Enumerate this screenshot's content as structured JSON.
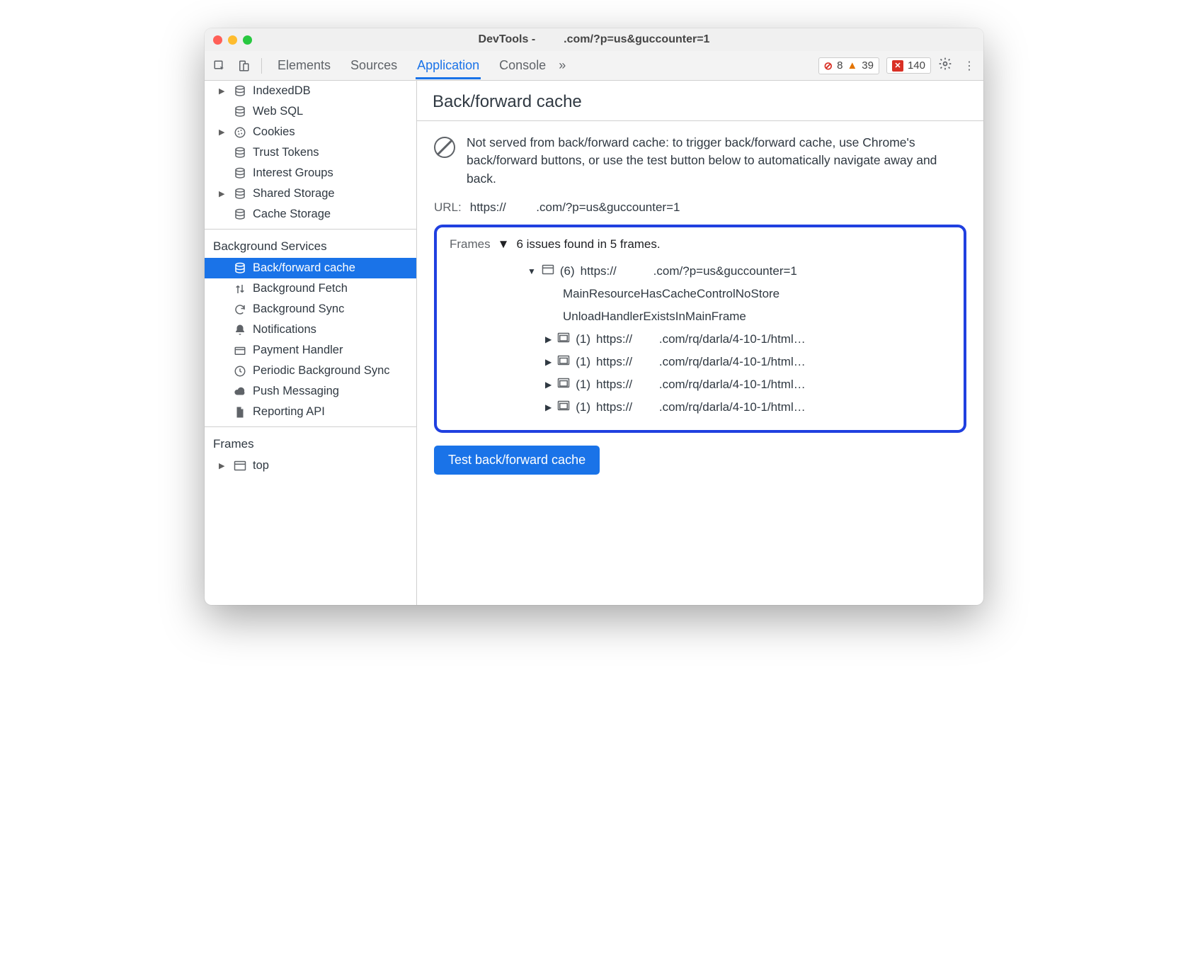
{
  "window": {
    "title_prefix": "DevTools -",
    "title_suffix": ".com/?p=us&guccounter=1"
  },
  "toolbar": {
    "tabs": [
      "Elements",
      "Sources",
      "Application",
      "Console"
    ],
    "active_tab": "Application",
    "overflow_glyph": "»",
    "errors": "8",
    "warnings": "39",
    "issues": "140"
  },
  "sidebar": {
    "storage": [
      {
        "label": "IndexedDB",
        "expandable": true,
        "icon": "db"
      },
      {
        "label": "Web SQL",
        "expandable": false,
        "icon": "db"
      },
      {
        "label": "Cookies",
        "expandable": true,
        "icon": "cookie"
      },
      {
        "label": "Trust Tokens",
        "expandable": false,
        "icon": "db"
      },
      {
        "label": "Interest Groups",
        "expandable": false,
        "icon": "db"
      },
      {
        "label": "Shared Storage",
        "expandable": true,
        "icon": "db"
      },
      {
        "label": "Cache Storage",
        "expandable": false,
        "icon": "db"
      }
    ],
    "bg_header": "Background Services",
    "bg": [
      {
        "label": "Back/forward cache",
        "icon": "db",
        "selected": true
      },
      {
        "label": "Background Fetch",
        "icon": "updown"
      },
      {
        "label": "Background Sync",
        "icon": "sync"
      },
      {
        "label": "Notifications",
        "icon": "bell"
      },
      {
        "label": "Payment Handler",
        "icon": "card"
      },
      {
        "label": "Periodic Background Sync",
        "icon": "clock"
      },
      {
        "label": "Push Messaging",
        "icon": "cloud"
      },
      {
        "label": "Reporting API",
        "icon": "doc"
      }
    ],
    "frames_header": "Frames",
    "frames": [
      {
        "label": "top",
        "expandable": true
      }
    ]
  },
  "main": {
    "title": "Back/forward cache",
    "info": "Not served from back/forward cache: to trigger back/forward cache, use Chrome's back/forward buttons, or use the test button below to automatically navigate away and back.",
    "url_label": "URL:",
    "url_prefix": "https://",
    "url_suffix": ".com/?p=us&guccounter=1",
    "frames_label": "Frames",
    "frames_summary": "6 issues found in 5 frames.",
    "root_frame": {
      "count": "(6)",
      "url_prefix": "https://",
      "url_suffix": ".com/?p=us&guccounter=1",
      "reasons": [
        "MainResourceHasCacheControlNoStore",
        "UnloadHandlerExistsInMainFrame"
      ],
      "children": [
        {
          "count": "(1)",
          "url_prefix": "https://",
          "url_suffix": ".com/rq/darla/4-10-1/html…"
        },
        {
          "count": "(1)",
          "url_prefix": "https://",
          "url_suffix": ".com/rq/darla/4-10-1/html…"
        },
        {
          "count": "(1)",
          "url_prefix": "https://",
          "url_suffix": ".com/rq/darla/4-10-1/html…"
        },
        {
          "count": "(1)",
          "url_prefix": "https://",
          "url_suffix": ".com/rq/darla/4-10-1/html…"
        }
      ]
    },
    "test_button": "Test back/forward cache"
  }
}
